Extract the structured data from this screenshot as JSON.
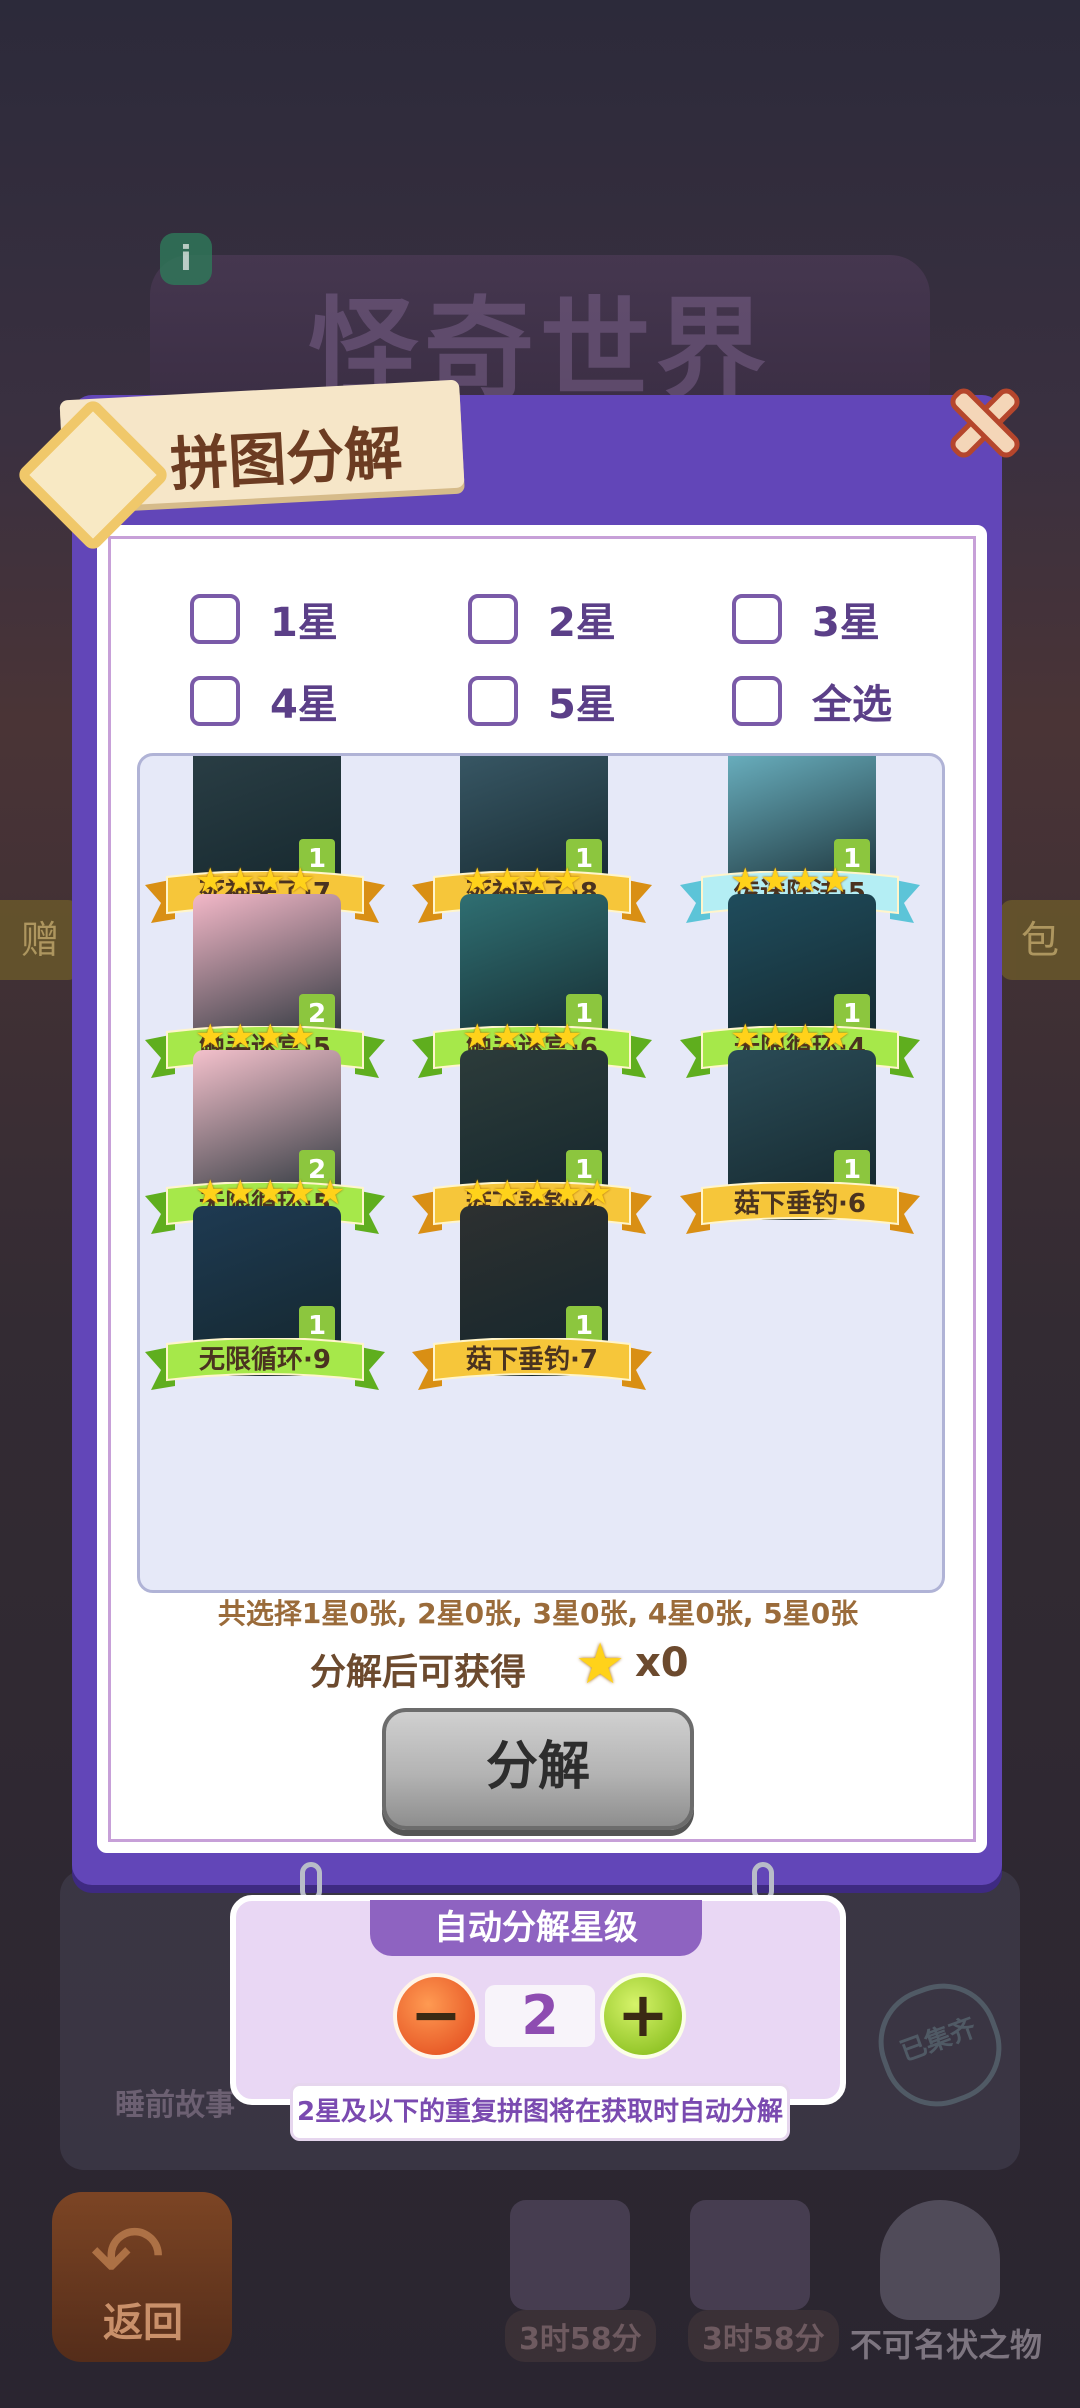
{
  "background": {
    "title": "怪奇世界",
    "left_tab": "赠",
    "right_tab": "包",
    "behind_card_text": "睡前故事",
    "stamp_text": "已集齐",
    "back_label": "返回",
    "timers": [
      "3时58分",
      "3时58分"
    ],
    "ghost_label": "不可名状之物"
  },
  "dialog": {
    "title": "拼图分解",
    "filters": [
      "1星",
      "2星",
      "3星",
      "4星",
      "5星",
      "全选"
    ],
    "puzzles": [
      {
        "label": "死神来了·7",
        "count": "1",
        "stars": 0,
        "ribbon": "gold"
      },
      {
        "label": "死神来了·8",
        "count": "1",
        "stars": 0,
        "ribbon": "gold"
      },
      {
        "label": "传送阵法·5",
        "count": "1",
        "stars": 0,
        "ribbon": "blue"
      },
      {
        "label": "触手迷宫·5",
        "count": "2",
        "stars": 4,
        "ribbon": "green"
      },
      {
        "label": "触手迷宫·6",
        "count": "1",
        "stars": 4,
        "ribbon": "green"
      },
      {
        "label": "无限循环·4",
        "count": "1",
        "stars": 4,
        "ribbon": "green"
      },
      {
        "label": "无限循环·5",
        "count": "2",
        "stars": 4,
        "ribbon": "green"
      },
      {
        "label": "菇下垂钓·4",
        "count": "1",
        "stars": 4,
        "ribbon": "gold"
      },
      {
        "label": "菇下垂钓·6",
        "count": "1",
        "stars": 4,
        "ribbon": "gold"
      },
      {
        "label": "无限循环·9",
        "count": "1",
        "stars": 5,
        "ribbon": "green"
      },
      {
        "label": "菇下垂钓·7",
        "count": "1",
        "stars": 5,
        "ribbon": "gold"
      }
    ],
    "summary": "共选择1星0张, 2星0张, 3星0张, 4星0张, 5星0张",
    "gain_label": "分解后可获得",
    "gain_count": "x0",
    "decompose_button": "分解"
  },
  "auto": {
    "title": "自动分解星级",
    "level": "2",
    "hint": "2星及以下的重复拼图将在获取时自动分解"
  },
  "colors": {
    "panel": "#6246b8",
    "ribbon_gold": "#f2b72a",
    "ribbon_green": "#8fdc3a",
    "ribbon_blue": "#9fe4ee",
    "count_badge": "#8cc63e"
  }
}
